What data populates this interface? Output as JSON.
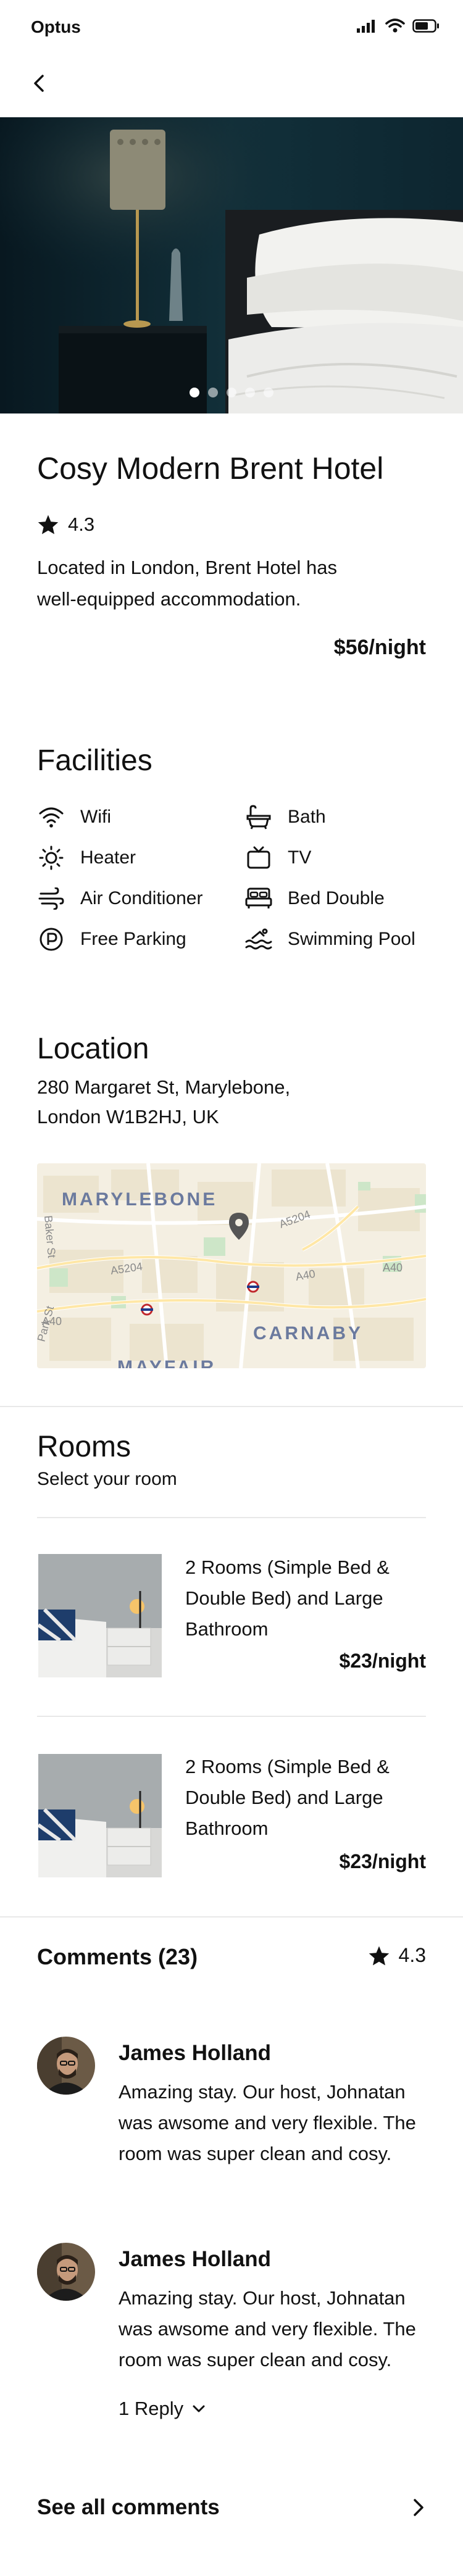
{
  "status_bar": {
    "carrier": "Optus"
  },
  "hotel": {
    "name": "Cosy Modern Brent Hotel",
    "rating": "4.3",
    "description": "Located in London, Brent Hotel has well-equipped accommodation.",
    "price": "$56/night",
    "carousel": {
      "count": 5,
      "active_index": 0
    }
  },
  "facilities": {
    "title": "Facilities",
    "items": [
      {
        "label": "Wifi",
        "icon": "wifi-icon"
      },
      {
        "label": "Bath",
        "icon": "bath-icon"
      },
      {
        "label": "Heater",
        "icon": "heater-icon"
      },
      {
        "label": "TV",
        "icon": "tv-icon"
      },
      {
        "label": "Air Conditioner",
        "icon": "air-conditioner-icon"
      },
      {
        "label": "Bed Double",
        "icon": "bed-icon"
      },
      {
        "label": "Free Parking",
        "icon": "parking-icon"
      },
      {
        "label": "Swimming Pool",
        "icon": "pool-icon"
      }
    ]
  },
  "location": {
    "title": "Location",
    "address_line1": "280 Margaret St, Marylebone,",
    "address_line2": "London W1B2HJ, UK",
    "map": {
      "labels": [
        "MARYLEBONE",
        "CARNABY",
        "MAYFAIR"
      ],
      "road_labels": [
        "A5204",
        "A5204",
        "A40",
        "A40",
        "A40",
        "Baker St",
        "Park St"
      ]
    }
  },
  "rooms": {
    "title": "Rooms",
    "subtitle": "Select your room",
    "items": [
      {
        "description": "2 Rooms (Simple Bed & Double Bed) and Large Bathroom",
        "price": "$23/night"
      },
      {
        "description": "2 Rooms (Simple Bed & Double Bed) and Large Bathroom",
        "price": "$23/night"
      }
    ]
  },
  "comments": {
    "title": "Comments (23)",
    "rating": "4.3",
    "items": [
      {
        "name": "James Holland",
        "text": "Amazing stay. Our host, Johnatan was awsome and very flexible. The room was super clean and cosy."
      },
      {
        "name": "James Holland",
        "text": "Amazing stay. Our host, Johnatan was awsome and very flexible. The room was super clean and cosy.",
        "reply": "1 Reply"
      }
    ],
    "see_all": "See all comments"
  },
  "colors": {
    "text": "#111111",
    "divider": "#e8e8e8",
    "hero_wall": "#0f2a33",
    "map_bg": "#f4efe2",
    "map_park": "#cde6c8"
  }
}
